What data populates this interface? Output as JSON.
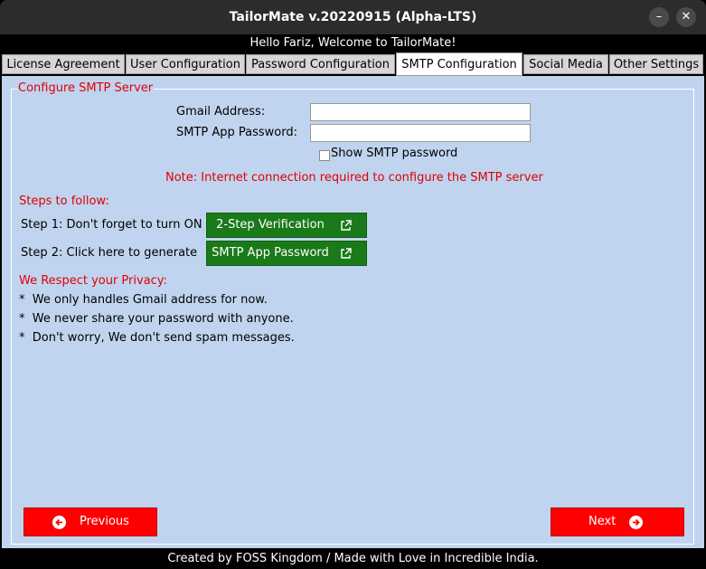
{
  "window": {
    "title": "TailorMate v.20220915 (Alpha-LTS)",
    "minimize_glyph": "–",
    "close_glyph": "✕"
  },
  "greeting": "Hello Fariz, Welcome to TailorMate!",
  "tabs": [
    {
      "label": "License Agreement"
    },
    {
      "label": "User Configuration"
    },
    {
      "label": "Password Configuration"
    },
    {
      "label": "SMTP Configuration",
      "active": true
    },
    {
      "label": "Social Media"
    },
    {
      "label": "Other Settings"
    }
  ],
  "smtp": {
    "group_title": "Configure SMTP Server",
    "gmail_label": "Gmail Address:",
    "gmail_value": "",
    "password_label": "SMTP App Password:",
    "password_value": "",
    "show_password_label": "Show SMTP password",
    "show_password_checked": false,
    "note": "Note: Internet connection required to configure the SMTP server",
    "steps_title": "Steps to follow:",
    "step1_label": "Step 1: Don't forget to turn ON",
    "step1_button": "2-Step Verification",
    "step2_label": "Step 2: Click here to generate",
    "step2_button": "SMTP App Password",
    "privacy_title": "We Respect your Privacy:",
    "privacy_items": [
      "*  We only handles Gmail address for now.",
      "*  We never share your password with anyone.",
      "*  Don't worry, We don't send spam messages."
    ]
  },
  "nav": {
    "previous_label": "Previous",
    "next_label": "Next"
  },
  "footer": "Created by FOSS Kingdom / Made with Love in Incredible India.",
  "colors": {
    "accent_red": "#ff0000",
    "link_green": "#1a7a1a",
    "panel_blue": "#c0d4ef",
    "label_red": "#e00000"
  },
  "icons": [
    "minimize-icon",
    "close-icon",
    "external-link-icon",
    "arrow-left-circle-icon",
    "arrow-right-circle-icon"
  ]
}
